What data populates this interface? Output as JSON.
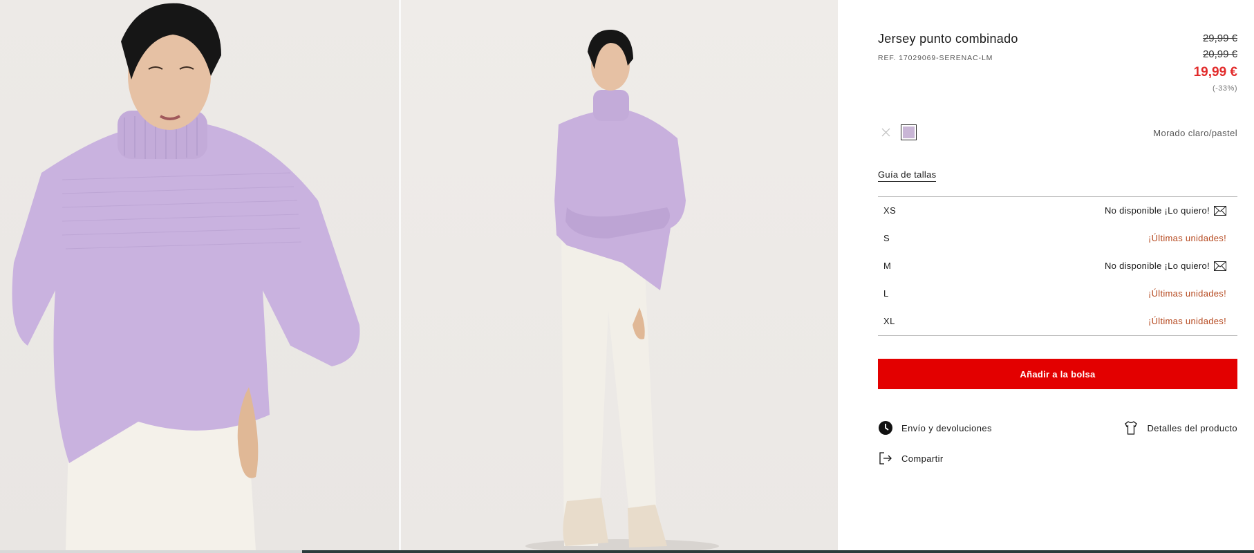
{
  "product": {
    "title": "Jersey punto combinado",
    "ref": "REF. 17029069-SERENAC-LM",
    "prices": {
      "original": "29,99 €",
      "previous": "20,99 €",
      "current": "19,99 €",
      "discount": "(-33%)"
    },
    "color": {
      "name": "Morado claro/pastel",
      "swatch": "#c9b6d6"
    }
  },
  "size_guide_label": "Guía de tallas",
  "sizes": [
    {
      "label": "XS",
      "status": "No disponible ¡Lo quiero!",
      "type": "unavailable"
    },
    {
      "label": "S",
      "status": "¡Últimas unidades!",
      "type": "last"
    },
    {
      "label": "M",
      "status": "No disponible ¡Lo quiero!",
      "type": "unavailable"
    },
    {
      "label": "L",
      "status": "¡Últimas unidades!",
      "type": "last"
    },
    {
      "label": "XL",
      "status": "¡Últimas unidades!",
      "type": "last"
    }
  ],
  "add_to_bag_label": "Añadir a la bolsa",
  "links": {
    "shipping": "Envío y devoluciones",
    "details": "Detalles del producto",
    "share": "Compartir"
  },
  "icons": {
    "unavailable_swatch": "cross-icon",
    "notify": "mail-icon",
    "shipping": "clock-icon",
    "details": "tshirt-icon",
    "share": "share-icon"
  },
  "colors": {
    "accent_red": "#e30000",
    "price_red": "#e22b2b",
    "low_stock": "#b5481e"
  }
}
